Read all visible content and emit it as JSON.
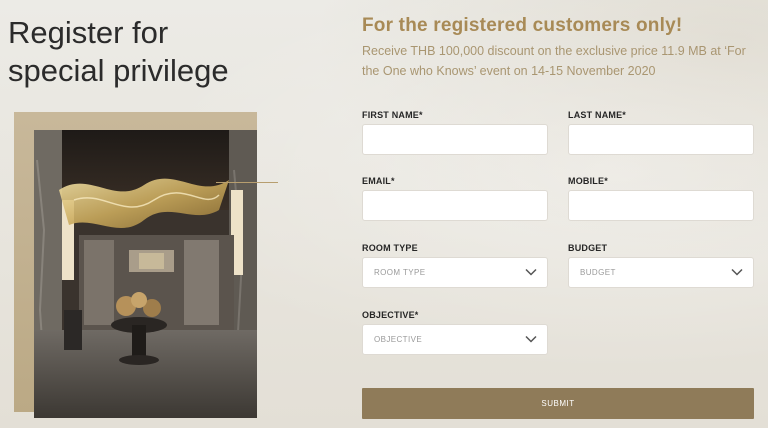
{
  "headline": [
    "Register for",
    "special privilege"
  ],
  "offer": {
    "title": "For the registered customers only!",
    "description": "Receive THB 100,000 discount on the exclusive price 11.9 MB at ‘For the One who Knows’ event on 14-15 November 2020"
  },
  "form": {
    "first_name_label": "FIRST NAME*",
    "last_name_label": "LAST NAME*",
    "email_label": "EMAIL*",
    "mobile_label": "MOBILE*",
    "room_type_label": "ROOM TYPE",
    "room_type_placeholder": "ROOM TYPE",
    "budget_label": "BUDGET",
    "budget_placeholder": "BUDGET",
    "objective_label": "OBJECTIVE*",
    "objective_placeholder": "OBJECTIVE",
    "submit_label": "SUBMIT"
  },
  "colors": {
    "accent_gold": "#a88a56",
    "button": "#8f7b59"
  },
  "icons": {
    "dropdown": "chevron-down-icon"
  }
}
